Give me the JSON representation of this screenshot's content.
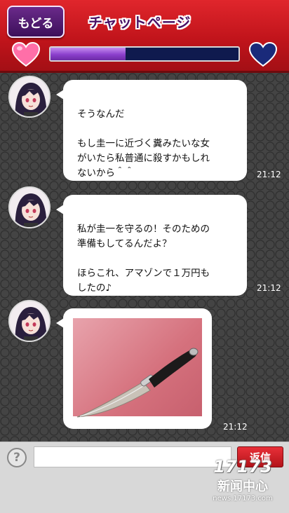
{
  "header": {
    "back_label": "もどる",
    "title": "チャットページ",
    "affection_level": 0.4,
    "heart_left_color": "#ff6fa8",
    "heart_right_color": "#1a2a7a"
  },
  "messages": [
    {
      "text": "そうなんだ\n\nもし圭一に近づく糞みたいな女\nがいたら私普通に殺すかもしれ\nないから＾＾",
      "time": "21:12"
    },
    {
      "text": "私が圭一を守るの！そのための\n準備もしてるんだよ？\n\nほらこれ、アマゾンで１万円も\nしたの♪",
      "time": "21:12"
    },
    {
      "image": "knife-photo",
      "time": "21:12"
    }
  ],
  "input": {
    "help_icon": "?",
    "placeholder": "",
    "send_label": "返信"
  },
  "watermark": {
    "logo": "17173",
    "cn": "新闻中心",
    "url": "news.17173.com"
  }
}
